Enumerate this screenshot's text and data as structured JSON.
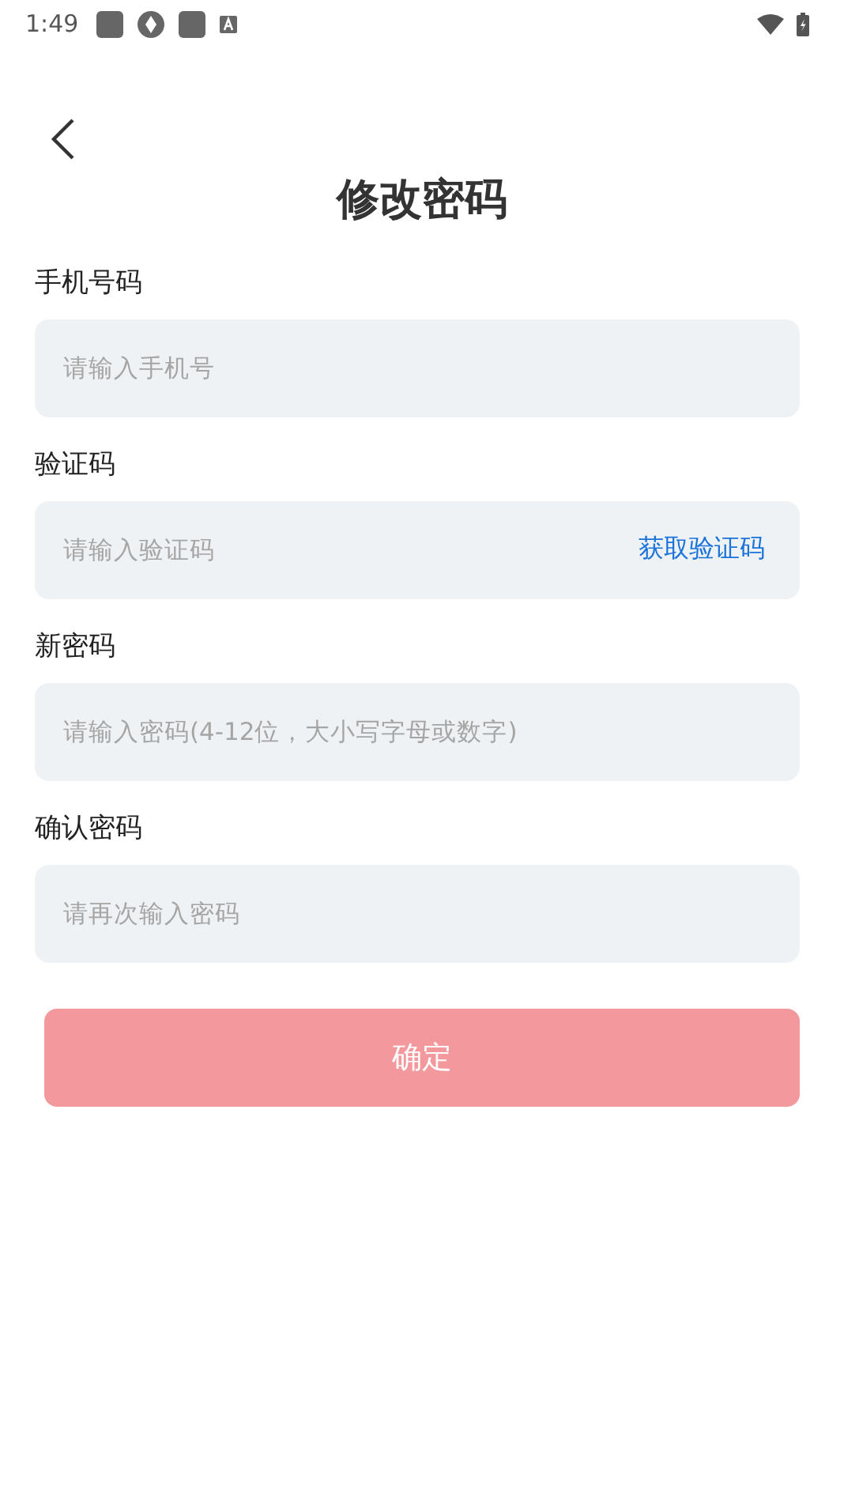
{
  "status_bar": {
    "time": "1:49"
  },
  "title": "修改密码",
  "fields": [
    {
      "label": "手机号码",
      "placeholder": "请输入手机号",
      "kind": "plain"
    },
    {
      "label": "验证码",
      "placeholder": "请输入验证码",
      "kind": "with-action",
      "action": "获取验证码"
    },
    {
      "label": "新密码",
      "placeholder": "请输入密码(4-12位，大小写字母或数字)",
      "kind": "plain"
    },
    {
      "label": "确认密码",
      "placeholder": "请再次输入密码",
      "kind": "plain"
    }
  ],
  "submit": {
    "label": "确定",
    "disabled": true
  }
}
